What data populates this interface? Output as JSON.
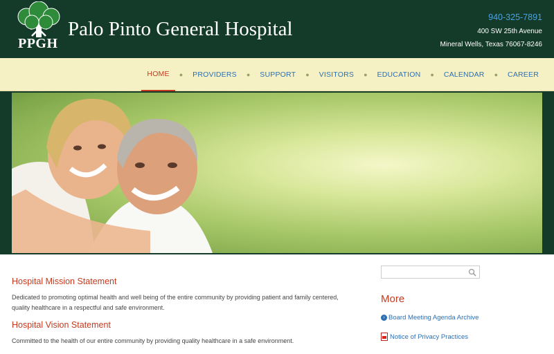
{
  "header": {
    "logo_text": "PPGH",
    "site_title": "Palo Pinto General Hospital",
    "phone": "940-325-7891",
    "address_line1": "400 SW 25th Avenue",
    "address_line2": "Mineral Wells, Texas 76067-8246"
  },
  "nav": {
    "items": [
      {
        "label": "HOME",
        "active": true
      },
      {
        "label": "PROVIDERS"
      },
      {
        "label": "SUPPORT"
      },
      {
        "label": "VISITORS"
      },
      {
        "label": "EDUCATION"
      },
      {
        "label": "CALENDAR"
      },
      {
        "label": "CAREER"
      }
    ]
  },
  "main": {
    "mission_title": "Hospital Mission Statement",
    "mission_text": "Dedicated to promoting optimal health and well being of the entire community by providing patient and family centered, quality healthcare in a respectful and safe environment.",
    "vision_title": "Hospital Vision Statement",
    "vision_text": "Committed to the health of our entire community by providing quality healthcare in a safe environment."
  },
  "sidebar": {
    "search_placeholder": "",
    "more_title": "More",
    "links": [
      {
        "label": "Board Meeting Agenda Archive",
        "icon": "chevron-right-circle-icon"
      },
      {
        "label": "Notice of Privacy Practices",
        "icon": "pdf-icon"
      }
    ]
  },
  "colors": {
    "header_bg": "#143a2a",
    "nav_bg": "#f6f1c4",
    "accent_red": "#c53a1f",
    "link_blue": "#2b6fb4"
  }
}
